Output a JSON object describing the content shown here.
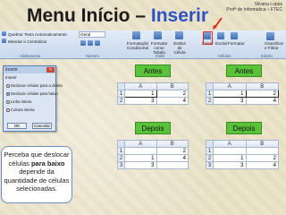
{
  "credit": {
    "line1": "Silvana Lopes",
    "line2": "Profª de Informática – FTEC"
  },
  "title": {
    "main": "Menu Início – ",
    "highlight": "Inserir"
  },
  "ribbon": {
    "wrap": "Quebrar Texto Automaticamente",
    "merge": "Mesclar e Centralizar",
    "number_format": "Geral",
    "cond": "Formatação Condicional",
    "as_table": "Formatar como Tabela",
    "styles": "Estilos de Célula",
    "insert": "Inserir",
    "delete": "Excluir",
    "format": "Formatar",
    "sort": "Classificar e Filtrar",
    "groups": {
      "align": "Alinhamento",
      "number": "Número",
      "style": "Estilo",
      "cells": "Células",
      "edit": "Edição"
    }
  },
  "dialog": {
    "title": "Inserir",
    "section": "Inserir",
    "options": [
      "Deslocar células para a direita",
      "Deslocar células para baixo",
      "Linha inteira",
      "Coluna inteira"
    ],
    "selected_index": 1,
    "ok": "OK",
    "cancel": "Cancelar"
  },
  "labels": {
    "before": "Antes",
    "after": "Depois"
  },
  "grids": {
    "col_headers": [
      "A",
      "B"
    ],
    "before_left": {
      "rows": [
        [
          "1",
          "1",
          "2"
        ],
        [
          "2",
          "3",
          "4"
        ]
      ]
    },
    "before_right": {
      "rows": [
        [
          "1",
          "1",
          "2"
        ],
        [
          "2",
          "3",
          "4"
        ]
      ]
    },
    "after_left": {
      "rows": [
        [
          "1",
          "",
          "2"
        ],
        [
          "2",
          "1",
          "4"
        ],
        [
          "3",
          "3",
          ""
        ]
      ]
    },
    "after_right": {
      "rows": [
        [
          "1",
          "",
          ""
        ],
        [
          "2",
          "1",
          "2"
        ],
        [
          "3",
          "3",
          "4"
        ]
      ]
    }
  },
  "note": {
    "p1": "Perceba que deslocar células ",
    "b1": "para baixo",
    "p2": " depende da quantidade de células selecionadas."
  },
  "colors": {
    "highlight": "#2d52c4",
    "label_bg": "#5ac23a",
    "insert_box": "#e22222"
  }
}
